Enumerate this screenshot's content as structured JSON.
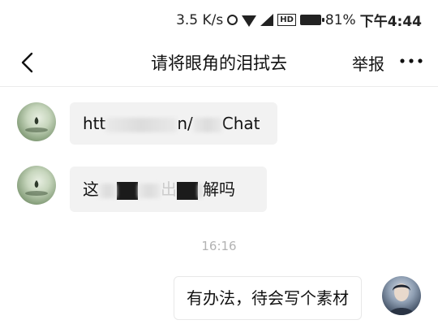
{
  "statusbar": {
    "speed": "3.5 K/s",
    "network_badge": "HD",
    "battery": "81%",
    "time": "下午4:44"
  },
  "navbar": {
    "title": "请将眼角的泪拭去",
    "report_label": "举报"
  },
  "messages": {
    "msg1_prefix": "htt",
    "msg1_middle": "n/",
    "msg1_suffix": "Chat",
    "msg2_prefix": "这",
    "msg2_middle": "出",
    "msg2_suffix": "解吗",
    "timestamp": "16:16",
    "msg3": "有办法，待会写个素材"
  },
  "colors": {
    "incoming_bubble": "#f2f2f2",
    "outgoing_bubble": "#ffffff",
    "timestamp_text": "#b3b3b3"
  }
}
